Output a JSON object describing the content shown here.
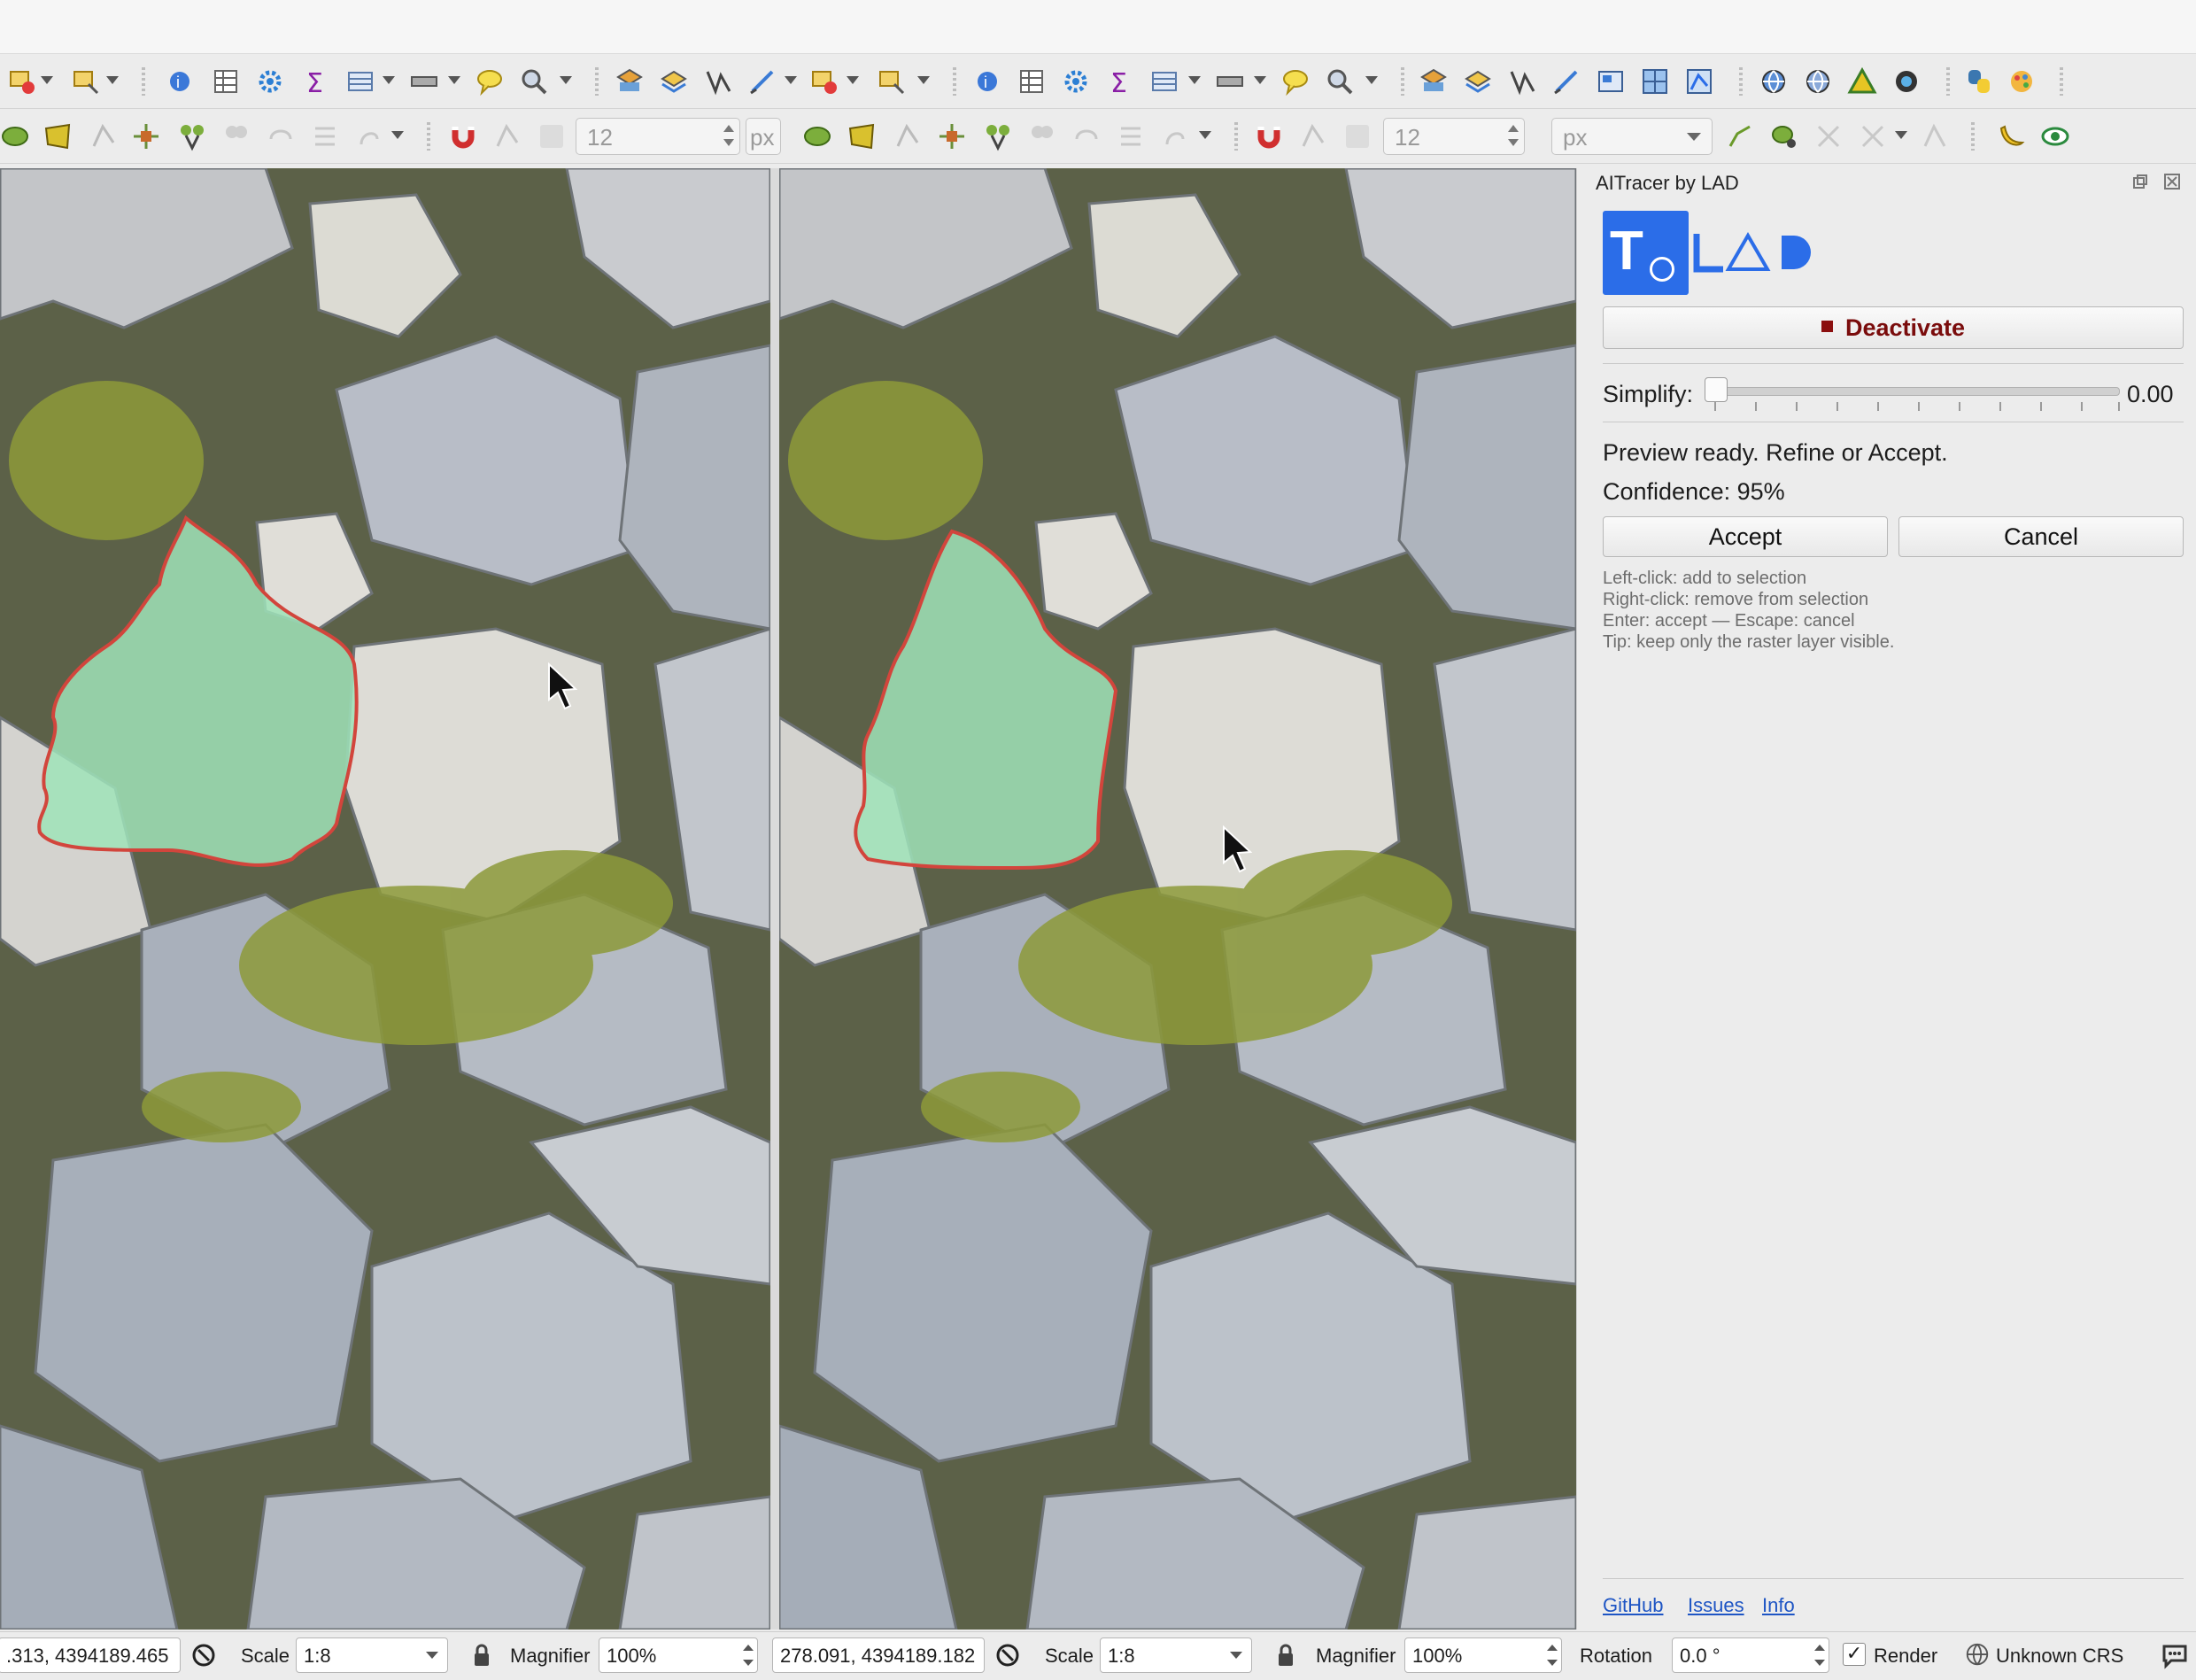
{
  "panel": {
    "title": "AITracer by LAD",
    "logo_glyph": "T",
    "deactivate_label": "Deactivate",
    "simplify_label": "Simplify:",
    "simplify_value": "0.00",
    "simplify_level": 0.0,
    "status_message": "Preview ready. Refine or Accept.",
    "confidence": "Confidence: 95%",
    "accept_label": "Accept",
    "cancel_label": "Cancel",
    "help": [
      "Left-click: add to selection",
      "Right-click: remove from selection",
      "Enter: accept — Escape: cancel",
      "Tip: keep only the raster layer visible."
    ],
    "links": [
      "GitHub",
      "Issues",
      "Info"
    ]
  },
  "toolbar2": {
    "left_size": "12",
    "left_unit": "px",
    "right_size": "12",
    "right_unit": "px"
  },
  "statusbar": {
    "left_coords": ".313, 4394189.465",
    "left_scale_label": "Scale",
    "left_scale": "1:8",
    "left_magnifier_label": "Magnifier",
    "left_magnifier": "100%",
    "right_coords": "278.091, 4394189.182",
    "right_scale_label": "Scale",
    "right_scale": "1:8",
    "right_magnifier_label": "Magnifier",
    "right_magnifier": "100%",
    "rotation_label": "Rotation",
    "rotation": "0.0 °",
    "render_label": "Render",
    "render_check": "✓",
    "crs_label": "Unknown CRS"
  },
  "colors": {
    "accent": "#2b6de8",
    "deactivate_text": "#7a0c0c",
    "selection_fill": "#9fe3b8",
    "selection_outline": "#d2453c",
    "link": "#1e55c4"
  },
  "icons": {
    "toolbar1": [
      "select-features-icon",
      "select-by-value-icon",
      "identify-icon",
      "attribute-table-icon",
      "statistics-icon",
      "sum-icon",
      "field-calculator-icon",
      "measure-icon",
      "map-tips-icon",
      "zoom-search-icon",
      "new-layer-icon",
      "add-layer-icon",
      "digitize-icon",
      "pen-icon",
      "layers-icon",
      "select-icon",
      "python-icon",
      "plugin-icon"
    ],
    "toolbar2": [
      "node-tool-icon",
      "polygon-icon",
      "split-icon",
      "snap-icon",
      "magnet-icon",
      "banana-icon",
      "eye-icon"
    ],
    "statusbar": [
      "messages-icon",
      "lock-icon",
      "crs-globe-icon",
      "chat-icon"
    ]
  }
}
